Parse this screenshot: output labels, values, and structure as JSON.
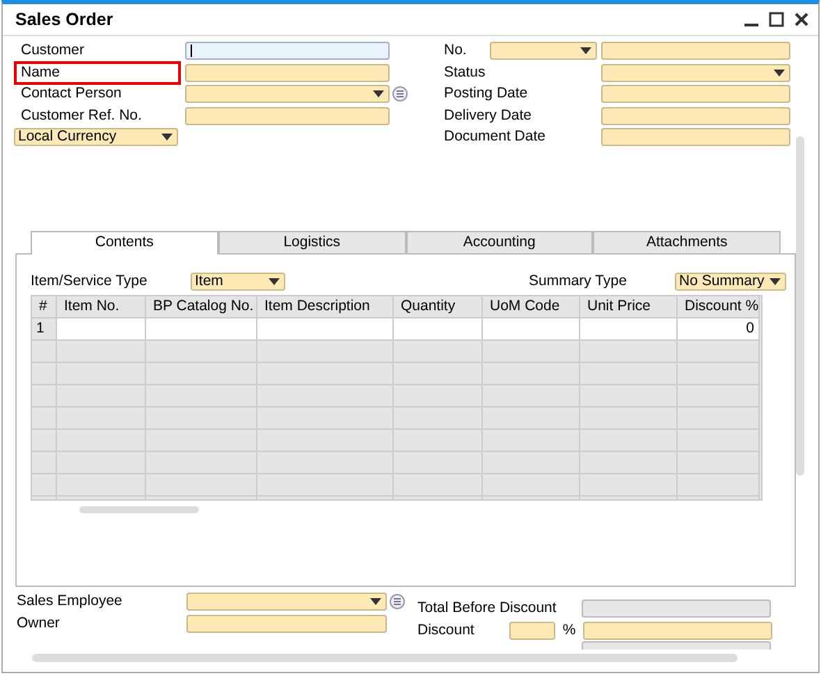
{
  "window": {
    "title": "Sales Order"
  },
  "header_left": [
    {
      "label": "Customer",
      "kind": "text",
      "focused": true,
      "highlighted": false
    },
    {
      "label": "Name",
      "kind": "text",
      "focused": false,
      "highlighted": true
    },
    {
      "label": "Contact Person",
      "kind": "dropdown-list",
      "focused": false,
      "highlighted": false
    },
    {
      "label": "Customer Ref. No.",
      "kind": "text",
      "focused": false,
      "highlighted": false
    }
  ],
  "currency": {
    "value": "Local Currency"
  },
  "header_right": [
    {
      "label": "No.",
      "kind": "series"
    },
    {
      "label": "Status",
      "kind": "dropdown"
    },
    {
      "label": "Posting Date",
      "kind": "text"
    },
    {
      "label": "Delivery Date",
      "kind": "text"
    },
    {
      "label": "Document Date",
      "kind": "text"
    }
  ],
  "tabs": [
    {
      "label": "Contents",
      "selected": true
    },
    {
      "label": "Logistics",
      "selected": false
    },
    {
      "label": "Accounting",
      "selected": false
    },
    {
      "label": "Attachments",
      "selected": false
    }
  ],
  "item_type": {
    "label": "Item/Service Type",
    "value": "Item"
  },
  "summary_type": {
    "label": "Summary Type",
    "value": "No Summary"
  },
  "table": {
    "columns": [
      "#",
      "Item No.",
      "BP Catalog No.",
      "Item Description",
      "Quantity",
      "UoM Code",
      "Unit Price",
      "Discount %"
    ],
    "rows": [
      {
        "number": "1",
        "discount": "0"
      }
    ]
  },
  "footer_left": [
    {
      "label": "Sales Employee",
      "kind": "dropdown-list"
    },
    {
      "label": "Owner",
      "kind": "text"
    }
  ],
  "footer_right": [
    {
      "label": "Total Before Discount",
      "kind": "readonly"
    },
    {
      "label": "Discount",
      "kind": "percent",
      "unit": "%"
    }
  ]
}
